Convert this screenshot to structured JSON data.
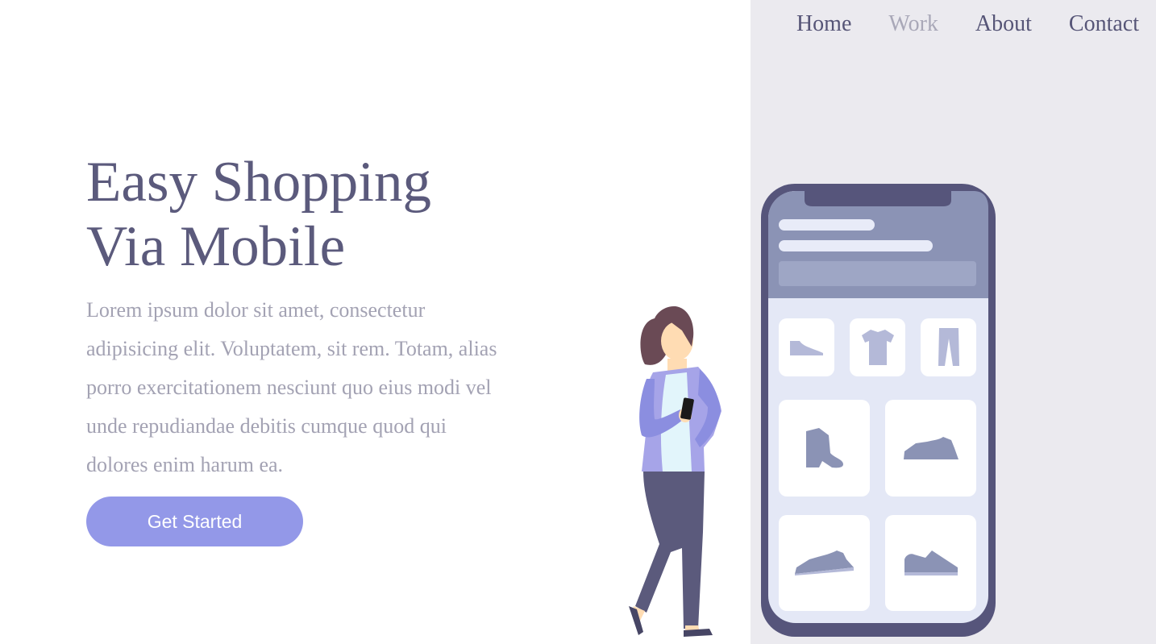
{
  "nav": {
    "items": [
      {
        "label": "Home"
      },
      {
        "label": "Work"
      },
      {
        "label": "About"
      },
      {
        "label": "Contact"
      }
    ]
  },
  "hero": {
    "title_line1": "Easy Shopping",
    "title_line2": "Via Mobile",
    "body": "Lorem ipsum dolor sit amet, consectetur adipisicing elit. Voluptatem, sit rem. Totam, alias porro exercitationem nesciunt quo eius modi vel unde repudiandae debitis cumque quod qui dolores enim harum ea.",
    "cta_label": "Get Started"
  },
  "illustration": {
    "icons": [
      "shoe-icon",
      "tshirt-icon",
      "pants-icon",
      "boot-icon",
      "sneaker-icon",
      "sneaker-icon",
      "sneaker-icon"
    ]
  },
  "colors": {
    "accent": "#9398e8",
    "heading": "#5b5a7c",
    "body_text": "#a3a2b3",
    "panel_bg": "#ebeaef",
    "phone_frame": "#56557b"
  }
}
